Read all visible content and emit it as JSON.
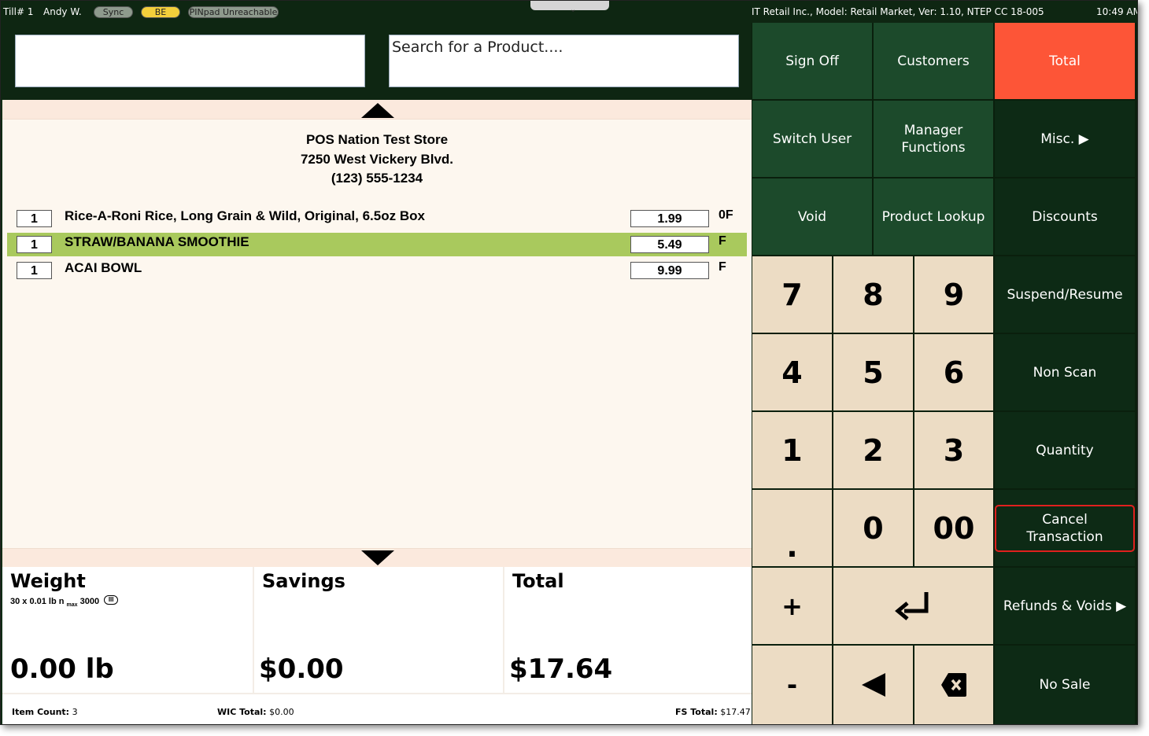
{
  "status_bar": {
    "till": "Till# 1",
    "user": "Andy W.",
    "sync": "Sync",
    "be": "BE",
    "pinpad": "PINpad Unreachable",
    "model_info": "IT Retail Inc., Model: Retail Market, Ver: 1.10, NTEP CC 18-005",
    "time": "10:49 AM"
  },
  "search": {
    "scan_value": "",
    "product_placeholder": "Search for a Product...."
  },
  "store": {
    "name": "POS Nation Test Store",
    "address": "7250 West Vickery Blvd.",
    "phone": "(123) 555-1234"
  },
  "lines": [
    {
      "qty": "1",
      "description": "Rice-A-Roni Rice, Long Grain & Wild, Original, 6.5oz Box",
      "price": "1.99",
      "flag": "0F",
      "selected": false
    },
    {
      "qty": "1",
      "description": "STRAW/BANANA SMOOTHIE",
      "price": "5.49",
      "flag": "F",
      "selected": true
    },
    {
      "qty": "1",
      "description": "ACAI BOWL",
      "price": "9.99",
      "flag": "F",
      "selected": false
    }
  ],
  "totals": {
    "weight_label": "Weight",
    "scale_capacity": "30 x 0.01 lb n",
    "scale_max_sub": "max",
    "scale_max": "3000",
    "scale_class": "III",
    "weight_value": "0.00 lb",
    "savings_label": "Savings",
    "savings_value": "$0.00",
    "total_label": "Total",
    "total_value": "$17.64"
  },
  "footer": {
    "item_count_label": "Item Count:",
    "item_count": "3",
    "wic_label": "WIC Total:",
    "wic_total": "$0.00",
    "fs_label": "FS Total:",
    "fs_total": "$17.47"
  },
  "keypad": {
    "sign_off": "Sign Off",
    "customers": "Customers",
    "total": "Total",
    "switch_user": "Switch User",
    "manager_functions": "Manager Functions",
    "misc": "Misc. ▶",
    "void": "Void",
    "product_lookup": "Product Lookup",
    "discounts": "Discounts",
    "suspend_resume": "Suspend/Resume",
    "non_scan": "Non Scan",
    "quantity": "Quantity",
    "cancel_transaction": "Cancel Transaction",
    "refunds_voids": "Refunds & Voids ▶",
    "no_sale": "No Sale",
    "digits": [
      "7",
      "8",
      "9",
      "4",
      "5",
      "6",
      "1",
      "2",
      "3",
      ".",
      "0",
      "00"
    ],
    "plus": "+",
    "minus": "-",
    "enter_icon": "enter-arrow",
    "back_icon": "left-triangle",
    "backspace_icon": "backspace-x"
  },
  "colors": {
    "keypad_green": "#1c4a2b",
    "keypad_dark": "#0d2a15",
    "total_red": "#fd5537",
    "digit_beige": "#ecdcc4",
    "selected_line": "#a9c95d",
    "cancel_outline": "#e0201e"
  }
}
